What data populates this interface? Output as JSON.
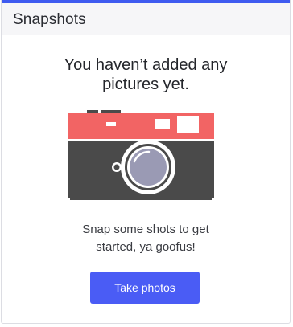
{
  "card": {
    "title": "Snapshots",
    "accent_color": "#3f5bf0"
  },
  "empty_state": {
    "heading_line1": "You haven’t added any",
    "heading_line2": "pictures yet.",
    "body_line1": "Snap some shots to get",
    "body_line2": "started, ya goofus!",
    "illustration": "camera-icon"
  },
  "actions": {
    "take_photos_label": "Take photos",
    "button_color": "#4a5cf5"
  }
}
